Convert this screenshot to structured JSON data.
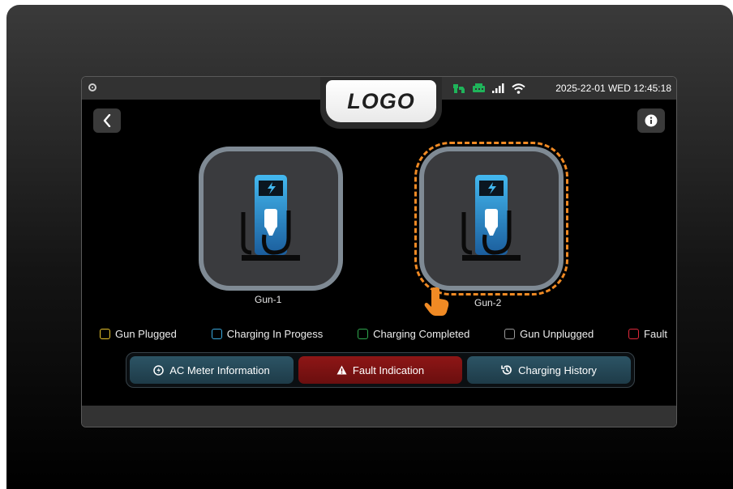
{
  "status_bar": {
    "logo_text": "LOGO",
    "datetime": "2025-22-01 WED 12:45:18",
    "icons": [
      "camera-icon",
      "charger-status-icon",
      "network-icon",
      "signal-icon",
      "wifi-icon"
    ],
    "icon_color": "#1fb45a"
  },
  "nav": {
    "back_icon": "chevron-left-icon",
    "info_icon": "info-icon"
  },
  "guns": [
    {
      "label": "Gun-1",
      "selected": false
    },
    {
      "label": "Gun-2",
      "selected": true
    }
  ],
  "selection_color": "#f08a24",
  "legend": [
    {
      "label": "Gun Plugged",
      "color": "#e7c22b"
    },
    {
      "label": "Charging In Progess",
      "color": "#3aa8dc"
    },
    {
      "label": "Charging Completed",
      "color": "#2fa84e"
    },
    {
      "label": "Gun Unplugged",
      "color": "#9a9a9a"
    },
    {
      "label": "Fault",
      "color": "#e0283a"
    }
  ],
  "tabs": [
    {
      "label": "AC Meter Information",
      "icon": "meter-icon"
    },
    {
      "label": "Fault Indication",
      "icon": "warning-icon"
    },
    {
      "label": "Charging History",
      "icon": "history-icon"
    }
  ]
}
